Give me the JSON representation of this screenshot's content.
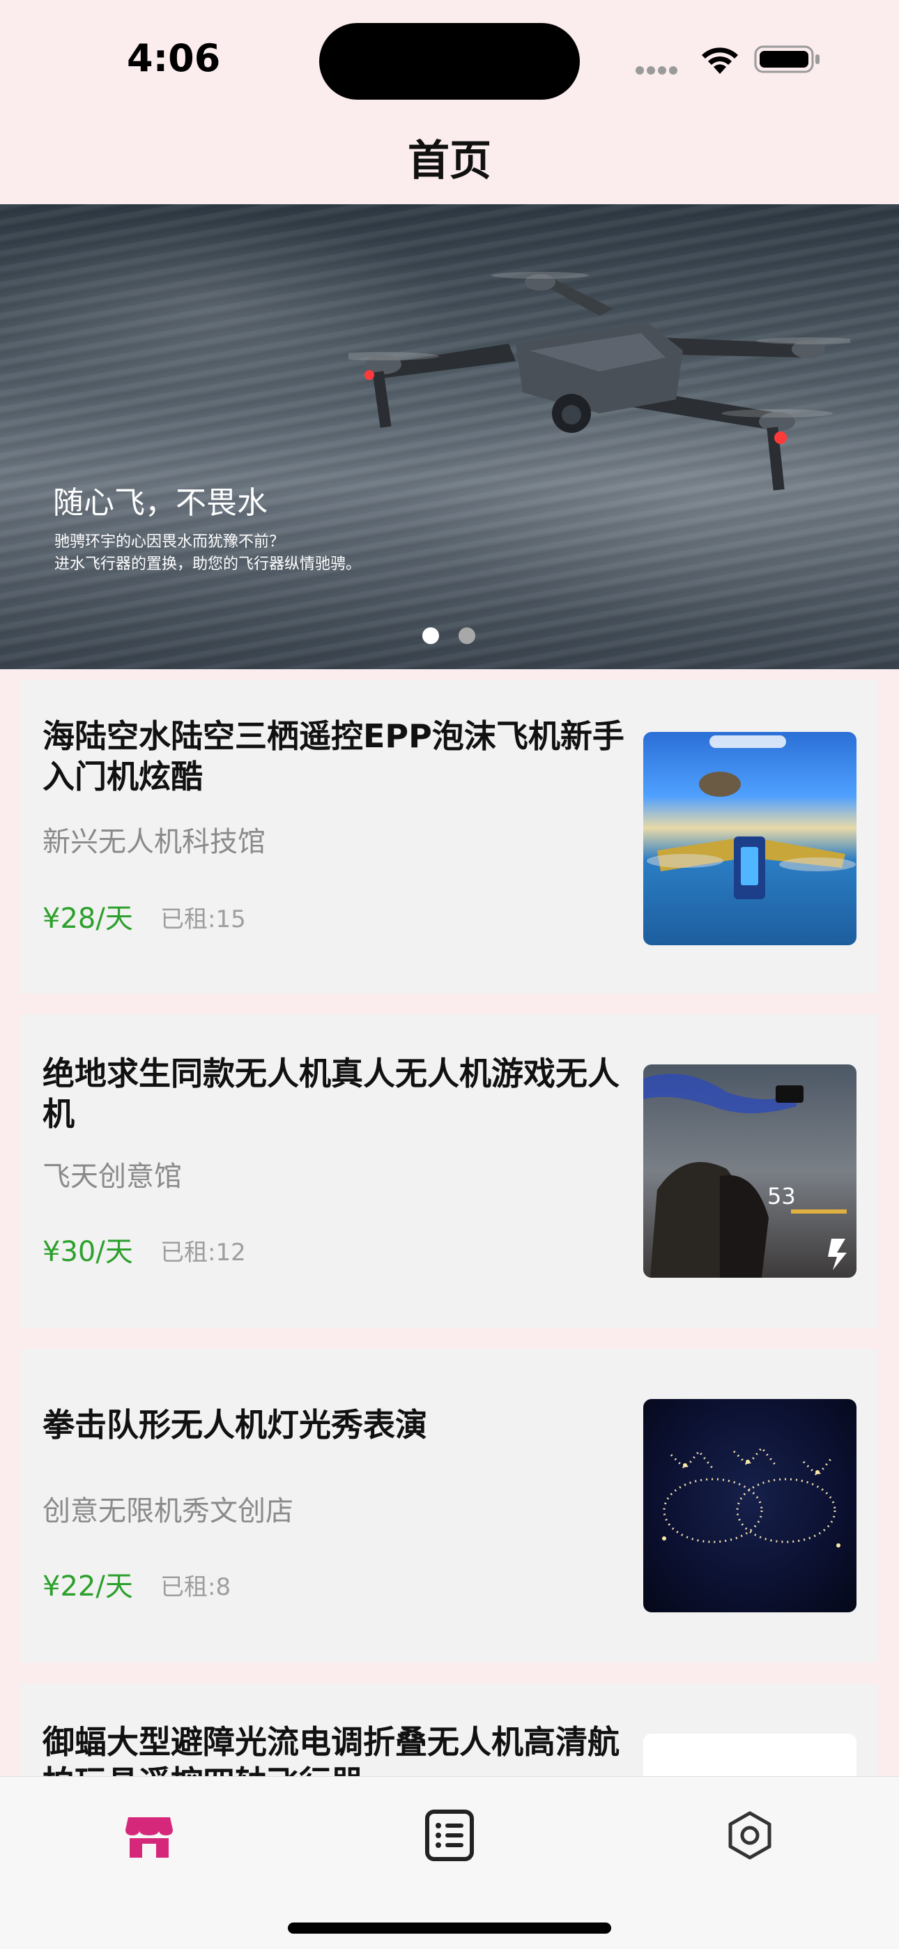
{
  "status_bar": {
    "time": "4:06"
  },
  "nav": {
    "title": "首页"
  },
  "banner": {
    "heading": "随心飞，不畏水",
    "subtitle_line1": "驰骋环宇的心因畏水而犹豫不前？",
    "subtitle_line2": "进水飞行器的置换，助您的飞行器纵情驰骋。",
    "current_page": 1,
    "total_pages": 2
  },
  "products": [
    {
      "title": "海陆空水陆空三栖遥控EPP泡沫飞机新手入门机炫酷",
      "shop": "新兴无人机科技馆",
      "price": "¥28/天",
      "rented": "已租:15"
    },
    {
      "title": "绝地求生同款无人机真人无人机游戏无人机",
      "shop": "飞天创意馆",
      "price": "¥30/天",
      "rented": "已租:12"
    },
    {
      "title": "拳击队形无人机灯光秀表演",
      "shop": "创意无限机秀文创店",
      "price": "¥22/天",
      "rented": "已租:8"
    },
    {
      "title": "御蝠大型避障光流电调折叠无人机高清航拍玩具遥控四轴飞行器"
    }
  ],
  "tab_bar": {
    "items": [
      {
        "icon": "store-icon",
        "active": true
      },
      {
        "icon": "list-icon",
        "active": false
      },
      {
        "icon": "settings-hexagon-icon",
        "active": false
      }
    ],
    "accent_color": "#d6287a"
  },
  "colors": {
    "background": "#fbeced",
    "card": "#f2f2f2",
    "price": "#2ca02c"
  }
}
